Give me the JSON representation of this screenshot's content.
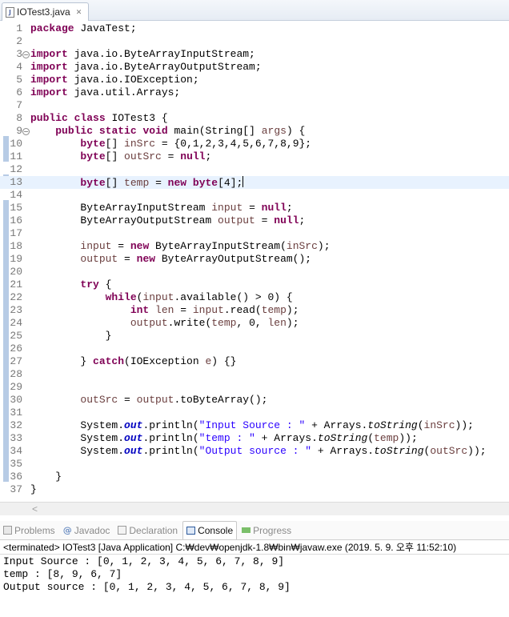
{
  "editor_tab": {
    "title": "IOTest3.java",
    "icon": "java-file-icon",
    "close_icon": "close-icon"
  },
  "editor": {
    "current_line": 13,
    "lines": [
      {
        "n": "1",
        "html": "<span class=\"kw\">package</span> JavaTest;"
      },
      {
        "n": "2",
        "html": ""
      },
      {
        "n": "3",
        "fold": true,
        "html": "<span class=\"kw\">import</span> java.io.ByteArrayInputStream;"
      },
      {
        "n": "4",
        "html": "<span class=\"kw\">import</span> java.io.ByteArrayOutputStream;"
      },
      {
        "n": "5",
        "html": "<span class=\"kw\">import</span> java.io.IOException;"
      },
      {
        "n": "6",
        "html": "<span class=\"kw\">import</span> java.util.Arrays;"
      },
      {
        "n": "7",
        "html": ""
      },
      {
        "n": "8",
        "html": "<span class=\"kw\">public</span> <span class=\"kw\">class</span> IOTest3 {"
      },
      {
        "n": "9",
        "fold": true,
        "html": "    <span class=\"kw\">public</span> <span class=\"kw\">static</span> <span class=\"kw\">void</span> main(String[] <span class=\"var\">args</span>) {"
      },
      {
        "n": "10",
        "html": "        <span class=\"kw\">byte</span>[] <span class=\"var\">inSrc</span> = {0,1,2,3,4,5,6,7,8,9};"
      },
      {
        "n": "11",
        "html": "        <span class=\"kw\">byte</span>[] <span class=\"var\">outSrc</span> = <span class=\"kw\">null</span>;"
      },
      {
        "n": "12",
        "html": ""
      },
      {
        "n": "13",
        "html": "        <span class=\"kw\">byte</span>[] <span class=\"var\">temp</span> = <span class=\"kw\">new</span> <span class=\"kw\">byte</span>[4];<span class=\"caret\"></span>"
      },
      {
        "n": "14",
        "html": ""
      },
      {
        "n": "15",
        "html": "        ByteArrayInputStream <span class=\"var\">input</span> = <span class=\"kw\">null</span>;"
      },
      {
        "n": "16",
        "html": "        ByteArrayOutputStream <span class=\"var\">output</span> = <span class=\"kw\">null</span>;"
      },
      {
        "n": "17",
        "html": ""
      },
      {
        "n": "18",
        "html": "        <span class=\"var\">input</span> = <span class=\"kw\">new</span> ByteArrayInputStream(<span class=\"var\">inSrc</span>);"
      },
      {
        "n": "19",
        "html": "        <span class=\"var\">output</span> = <span class=\"kw\">new</span> ByteArrayOutputStream();"
      },
      {
        "n": "20",
        "html": ""
      },
      {
        "n": "21",
        "html": "        <span class=\"kw\">try</span> {"
      },
      {
        "n": "22",
        "html": "            <span class=\"kw\">while</span>(<span class=\"var\">input</span>.available() &gt; 0) {"
      },
      {
        "n": "23",
        "html": "                <span class=\"kw\">int</span> <span class=\"var\">len</span> = <span class=\"var\">input</span>.read(<span class=\"var\">temp</span>);"
      },
      {
        "n": "24",
        "html": "                <span class=\"var\">output</span>.write(<span class=\"var\">temp</span>, 0, <span class=\"var\">len</span>);"
      },
      {
        "n": "25",
        "html": "            }"
      },
      {
        "n": "26",
        "html": ""
      },
      {
        "n": "27",
        "html": "        } <span class=\"kw\">catch</span>(IOException <span class=\"var\">e</span>) {}"
      },
      {
        "n": "28",
        "html": ""
      },
      {
        "n": "29",
        "html": ""
      },
      {
        "n": "30",
        "html": "        <span class=\"var\">outSrc</span> = <span class=\"var\">output</span>.toByteArray();"
      },
      {
        "n": "31",
        "html": ""
      },
      {
        "n": "32",
        "html": "        System.<span class=\"fld\">out</span>.println(<span class=\"str\">\"Input Source : \"</span> + Arrays.<span class=\"stat\">toString</span>(<span class=\"var\">inSrc</span>));"
      },
      {
        "n": "33",
        "html": "        System.<span class=\"fld\">out</span>.println(<span class=\"str\">\"temp : \"</span> + Arrays.<span class=\"stat\">toString</span>(<span class=\"var\">temp</span>));"
      },
      {
        "n": "34",
        "html": "        System.<span class=\"fld\">out</span>.println(<span class=\"str\">\"Output source : \"</span> + Arrays.<span class=\"stat\">toString</span>(<span class=\"var\">outSrc</span>));"
      },
      {
        "n": "35",
        "html": ""
      },
      {
        "n": "36",
        "html": "    }"
      },
      {
        "n": "37",
        "html": "}"
      }
    ]
  },
  "panel": {
    "tabs": [
      {
        "label": "Problems",
        "icon": "problems-icon",
        "active": false
      },
      {
        "label": "Javadoc",
        "icon": "javadoc-icon",
        "active": false
      },
      {
        "label": "Declaration",
        "icon": "declaration-icon",
        "active": false
      },
      {
        "label": "Console",
        "icon": "console-icon",
        "active": true
      },
      {
        "label": "Progress",
        "icon": "progress-icon",
        "active": false
      }
    ],
    "launch_info": "<terminated> IOTest3 [Java Application] C:₩dev₩openjdk-1.8₩bin₩javaw.exe (2019. 5. 9. 오후 11:52:10)",
    "console_output": [
      "Input Source : [0, 1, 2, 3, 4, 5, 6, 7, 8, 9]",
      "temp : [8, 9, 6, 7]",
      "Output source : [0, 1, 2, 3, 4, 5, 6, 7, 8, 9]"
    ]
  },
  "colors": {
    "keyword": "#7f0055",
    "string": "#2a00ff",
    "local_variable": "#6a3e3e",
    "static_field": "#0000c0",
    "current_line": "#e8f2fe"
  }
}
